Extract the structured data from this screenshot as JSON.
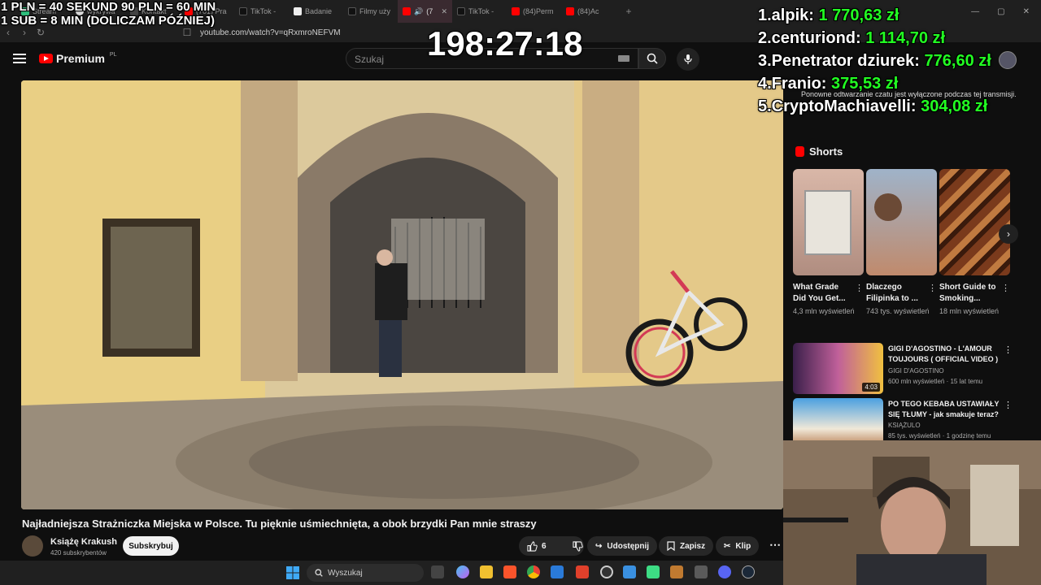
{
  "browser": {
    "tabs": [
      {
        "label": "Stream",
        "color": "#2ec27e"
      },
      {
        "label": "wykrywa",
        "color": "#dddddd"
      },
      {
        "label": "Kontakt",
        "color": "#444444"
      },
      {
        "label": "(701) Pra",
        "color": "#ff0000"
      },
      {
        "label": "TikTok - ",
        "color": "#111111"
      },
      {
        "label": "Badanie",
        "color": "#eeeeee"
      },
      {
        "label": "Filmy uży",
        "color": "#111111"
      },
      {
        "label": "(7",
        "color": "#ff0000"
      },
      {
        "label": "TikTok - ",
        "color": "#111111"
      },
      {
        "label": "(84)Perm",
        "color": "#ff0000"
      },
      {
        "label": "(84)Ac",
        "color": "#ff0000"
      }
    ],
    "url": "youtube.com/watch?v=qRxmroNEFVM"
  },
  "header": {
    "logo_text": "Premium",
    "logo_region": "PL",
    "search_placeholder": "Szukaj"
  },
  "video": {
    "title": "Najładniejsza Strażniczka Miejska w Polsce. Tu pięknie uśmiechnięta, a obok brzydki Pan mnie straszy",
    "channel": "Książę Krakush",
    "subscribers": "420 subskrybentów",
    "subscribe_label": "Subskrybuj",
    "likes": "6",
    "share_label": "Udostępnij",
    "save_label": "Zapisz",
    "clip_label": "Klip"
  },
  "sidebar": {
    "chat_note": "Ponowne odtwarzanie czatu jest wyłączone podczas tej transmisji.",
    "shorts_title": "Shorts",
    "shorts": [
      {
        "title": "What Grade Did You Get...",
        "views": "4,3 mln wyświetleń"
      },
      {
        "title": "Dlaczego Filipinka to ...",
        "views": "743 tys. wyświetleń"
      },
      {
        "title": "Short Guide to Smoking...",
        "views": "18 mln wyświetleń"
      }
    ],
    "recommendations": [
      {
        "title": "GIGI D'AGOSTINO - L'AMOUR TOUJOURS ( OFFICIAL VIDEO )",
        "channel": "GIGI D'AGOSTINO",
        "meta": "600 mln wyświetleń · 15 lat temu",
        "duration": "4:03"
      },
      {
        "title": "PO TEGO KEBABA USTAWIAŁY SIĘ TŁUMY - jak smakuje teraz?",
        "channel": "KSIĄŻULO",
        "meta": "85 tys. wyświetleń · 1 godzinę temu",
        "duration": ""
      }
    ]
  },
  "taskbar": {
    "search_label": "Wyszukaj"
  },
  "overlay": {
    "line1": "1 PLN =  40 SEKUND 90 PLN = 60 MIN",
    "line2": "1 SUB = 8 MIN (DOLICZAM PÓŹNIEJ)",
    "timer": "198:27:18",
    "donors": [
      {
        "rank_name": "1.alpik:",
        "amount": "1 770,63 zł"
      },
      {
        "rank_name": "2.centuriond:",
        "amount": "1 114,70 zł"
      },
      {
        "rank_name": "3.Penetrator dziurek:",
        "amount": "776,60 zł"
      },
      {
        "rank_name": "4.Franio:",
        "amount": "375,53 zł"
      },
      {
        "rank_name": "5.CryptoMachiavelli:",
        "amount": "304,08 zł"
      }
    ]
  },
  "colors": {
    "accent_red": "#ff0000",
    "donation_green": "#22ff22",
    "background": "#0f0f0f"
  }
}
